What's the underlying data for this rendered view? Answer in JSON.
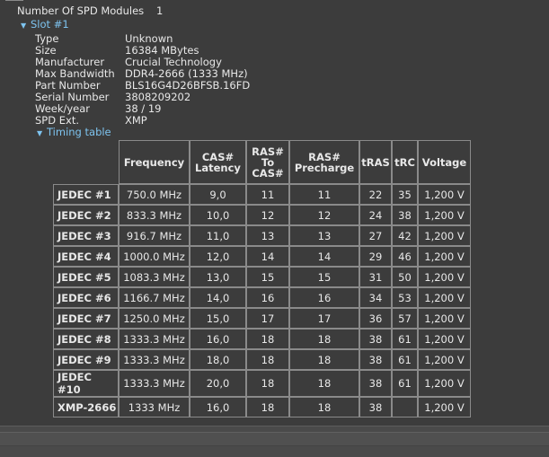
{
  "spd": {
    "label": "Number Of SPD Modules",
    "value": "1"
  },
  "slot": {
    "title": "Slot #1",
    "properties": [
      {
        "label": "Type",
        "value": "Unknown"
      },
      {
        "label": "Size",
        "value": "16384 MBytes"
      },
      {
        "label": "Manufacturer",
        "value": "Crucial Technology"
      },
      {
        "label": "Max Bandwidth",
        "value": "DDR4-2666 (1333 MHz)"
      },
      {
        "label": "Part Number",
        "value": "BLS16G4D26BFSB.16FD"
      },
      {
        "label": "Serial Number",
        "value": "3808209202"
      },
      {
        "label": "Week/year",
        "value": "38 / 19"
      },
      {
        "label": "SPD Ext.",
        "value": "XMP"
      }
    ]
  },
  "timing": {
    "title": "Timing table",
    "headers": [
      "Frequency",
      "CAS# Latency",
      "RAS# To CAS#",
      "RAS# Precharge",
      "tRAS",
      "tRC",
      "Voltage"
    ],
    "rows": [
      {
        "name": "JEDEC #1",
        "cells": [
          "750.0 MHz",
          "9,0",
          "11",
          "11",
          "22",
          "35",
          "1,200 V"
        ]
      },
      {
        "name": "JEDEC #2",
        "cells": [
          "833.3 MHz",
          "10,0",
          "12",
          "12",
          "24",
          "38",
          "1,200 V"
        ]
      },
      {
        "name": "JEDEC #3",
        "cells": [
          "916.7 MHz",
          "11,0",
          "13",
          "13",
          "27",
          "42",
          "1,200 V"
        ]
      },
      {
        "name": "JEDEC #4",
        "cells": [
          "1000.0 MHz",
          "12,0",
          "14",
          "14",
          "29",
          "46",
          "1,200 V"
        ]
      },
      {
        "name": "JEDEC #5",
        "cells": [
          "1083.3 MHz",
          "13,0",
          "15",
          "15",
          "31",
          "50",
          "1,200 V"
        ]
      },
      {
        "name": "JEDEC #6",
        "cells": [
          "1166.7 MHz",
          "14,0",
          "16",
          "16",
          "34",
          "53",
          "1,200 V"
        ]
      },
      {
        "name": "JEDEC #7",
        "cells": [
          "1250.0 MHz",
          "15,0",
          "17",
          "17",
          "36",
          "57",
          "1,200 V"
        ]
      },
      {
        "name": "JEDEC #8",
        "cells": [
          "1333.3 MHz",
          "16,0",
          "18",
          "18",
          "38",
          "61",
          "1,200 V"
        ]
      },
      {
        "name": "JEDEC #9",
        "cells": [
          "1333.3 MHz",
          "18,0",
          "18",
          "18",
          "38",
          "61",
          "1,200 V"
        ]
      },
      {
        "name": "JEDEC #10",
        "cells": [
          "1333.3 MHz",
          "20,0",
          "18",
          "18",
          "38",
          "61",
          "1,200 V"
        ]
      },
      {
        "name": "XMP-2666",
        "cells": [
          "1333 MHz",
          "16,0",
          "18",
          "18",
          "38",
          "",
          "1,200 V"
        ]
      }
    ]
  },
  "icons": {
    "expand": "triangle-down-icon"
  },
  "colors": {
    "background": "#3c3c3c",
    "text": "#e8e8e8",
    "tree_header": "#7ec4f0",
    "grid": "#8a8a8a"
  }
}
